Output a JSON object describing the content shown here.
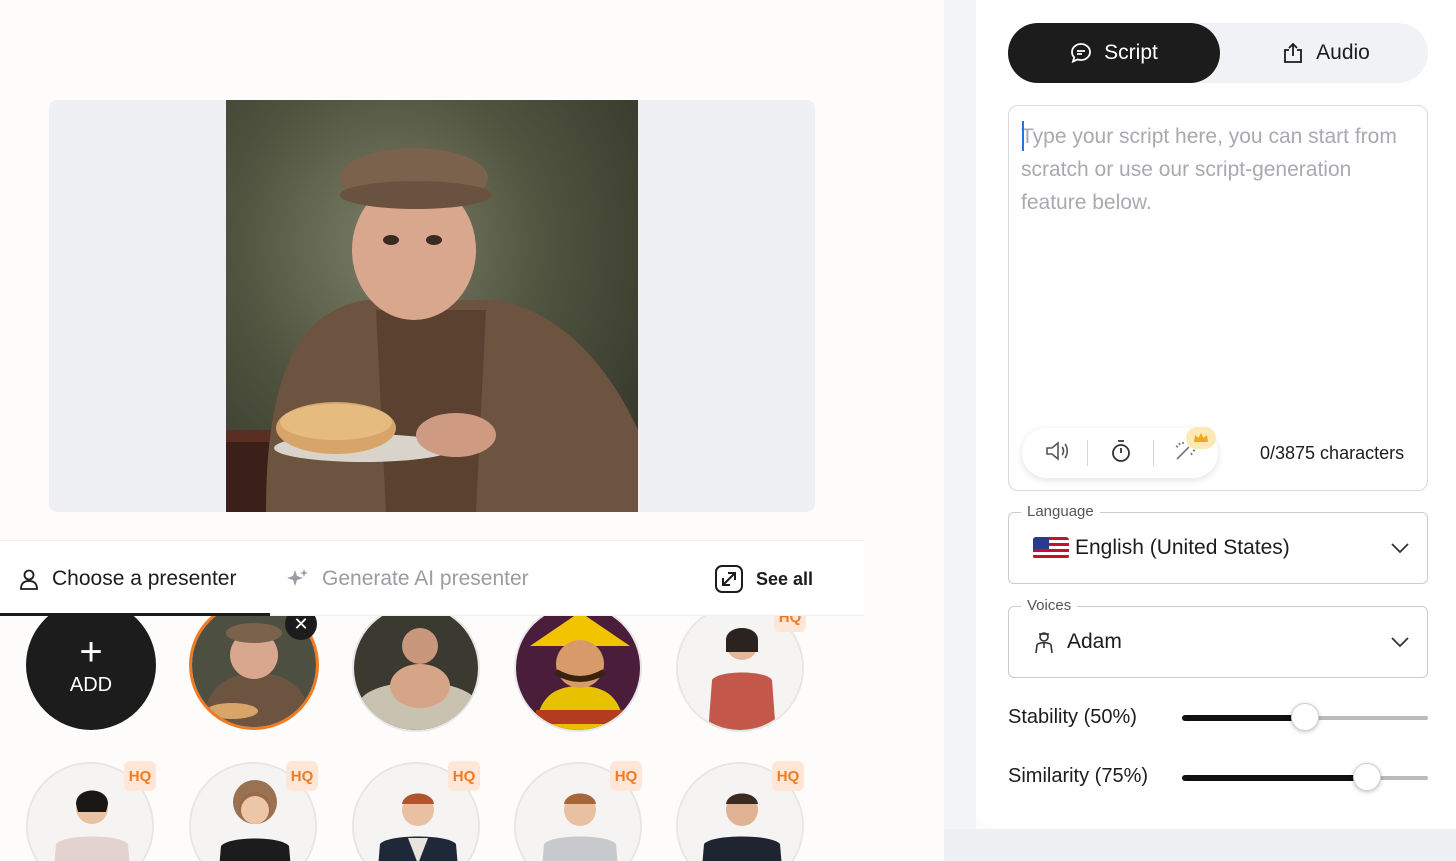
{
  "preview": {
    "image_alt": "portrait-of-man-in-flat-cap-with-bread"
  },
  "presenter_tabs": {
    "choose_label": "Choose a presenter",
    "generate_label": "Generate AI presenter",
    "see_all_label": "See all"
  },
  "avatars": {
    "add_label": "ADD",
    "plus_glyph": "+",
    "close_glyph": "✕",
    "hq_badge": "HQ"
  },
  "mode_toggle": {
    "script_label": "Script",
    "audio_label": "Audio",
    "selected": "Script"
  },
  "script": {
    "placeholder": "Type your script here, you can start from scratch or use our script-generation feature below.",
    "value": "",
    "char_count": "0/3875 characters"
  },
  "language": {
    "label": "Language",
    "value": "English (United States)"
  },
  "voices": {
    "label": "Voices",
    "value": "Adam"
  },
  "stability": {
    "label": "Stability (50%)",
    "value": 0.5
  },
  "similarity": {
    "label": "Similarity (75%)",
    "value": 0.75
  },
  "colors": {
    "accent_selected": "#f07b22",
    "dark": "#1c1c1c",
    "hq_text": "#f07b22",
    "hq_bg": "#ffe6d6"
  }
}
